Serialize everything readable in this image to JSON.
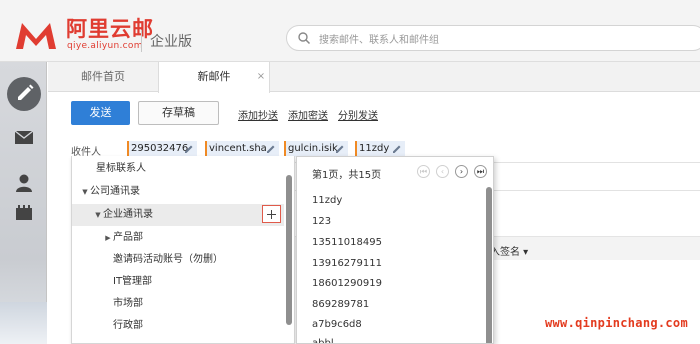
{
  "brand": {
    "name": "阿里云邮",
    "url": "qiye.aliyun.com",
    "edition": "企业版",
    "color": "#e03c31"
  },
  "search": {
    "placeholder": "搜索邮件、联系人和邮件组"
  },
  "rail": {
    "items": [
      "compose-icon",
      "mail-icon",
      "contacts-icon",
      "calendar-icon"
    ]
  },
  "tabs": [
    {
      "label": "邮件首页"
    },
    {
      "label": "新邮件",
      "close": "×"
    }
  ],
  "toolbar": {
    "send_label": "发送",
    "draft_label": "存草稿",
    "add_cc": "添加抄送",
    "add_bcc": "添加密送",
    "separate_send": "分别发送"
  },
  "recipients": {
    "label": "收件人",
    "items": [
      "295032476",
      "vincent.sha",
      "gulcin.isik",
      "11zdy"
    ]
  },
  "signature": {
    "label": "入签名"
  },
  "contact_tree": {
    "items": [
      {
        "label": "星标联系人"
      },
      {
        "label": "公司通讯录",
        "expanded": true
      },
      {
        "label": "企业通讯录",
        "expanded": true
      },
      {
        "label": "产品部",
        "expanded": false
      },
      {
        "label": "邀请码活动账号（勿删）"
      },
      {
        "label": "IT管理部"
      },
      {
        "label": "市场部"
      },
      {
        "label": "行政部"
      }
    ]
  },
  "contact_list": {
    "page_info": "第1页，共15页",
    "items": [
      "11zdy",
      "123",
      "13511018495",
      "13916279111",
      "18601290919",
      "869289781",
      "a7b9c6d8",
      "abbl"
    ]
  },
  "watermark": "www.qinpinchang.com",
  "colors": {
    "accent": "#2f7fd7",
    "chip_mark": "#f08a24"
  }
}
